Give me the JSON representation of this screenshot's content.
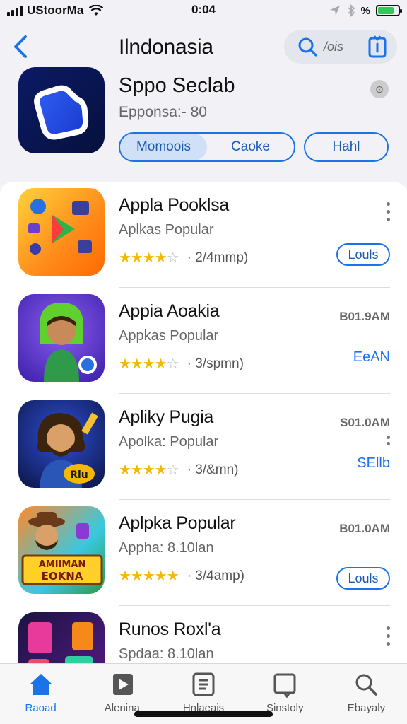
{
  "status_bar": {
    "carrier": "UStoorMa",
    "time": "0:04",
    "percent_glyph": "%",
    "battery_level": 0.8
  },
  "nav": {
    "title": "Ilndonasia",
    "search_text": "/ois"
  },
  "app": {
    "name": "Sppo Seclab",
    "subtitle": "Epponsa:- 80",
    "segments": [
      "Momoois",
      "Caoke"
    ],
    "half_button": "Hahl"
  },
  "list": [
    {
      "title": "Appla Pooklsa",
      "subtitle": "Aplkas Popular",
      "stars": "★★★★",
      "half_star": "☆",
      "rating_text": "· 2/4mmp)",
      "right_action": "Louls"
    },
    {
      "title": "Appia Aoakia",
      "subtitle": "Appkas Popular",
      "stars": "★★★★",
      "half_star": "☆",
      "rating_text": "· 3/spmn)",
      "right_text": "B01.9AM",
      "right_action": "EeAN"
    },
    {
      "title": "Apliky Pugia",
      "subtitle": "Apolka: Popular",
      "stars": "★★★★",
      "half_star": "☆",
      "rating_text": "· 3/&mn)",
      "right_text": "S01.0AM",
      "right_action": "SEllb"
    },
    {
      "title": "Aplpka Popular",
      "subtitle": "Appha: 8.10lan",
      "stars": "★★★★★",
      "half_star": "",
      "rating_text": "· 3/4amp)",
      "right_text": "B01.0AM",
      "right_action": "Louls"
    },
    {
      "title": "Runos Roxl'a",
      "subtitle": "Spdaa: 8.10lan"
    }
  ],
  "icon_texts": {
    "row4_banner_1": "AMIIMAN",
    "row4_banner_2": "EOKNA",
    "row3_badge": "Rlu"
  },
  "tabs": [
    {
      "label": "Raoad",
      "icon": "home-icon"
    },
    {
      "label": "Alenina",
      "icon": "play-icon"
    },
    {
      "label": "Hnlaeais",
      "icon": "document-icon"
    },
    {
      "label": "Sinstoly",
      "icon": "square-icon"
    },
    {
      "label": "Ebayaly",
      "icon": "search-icon"
    }
  ],
  "colors": {
    "accent": "#1a73e8",
    "star": "#f5b800",
    "battery": "#34c759"
  }
}
